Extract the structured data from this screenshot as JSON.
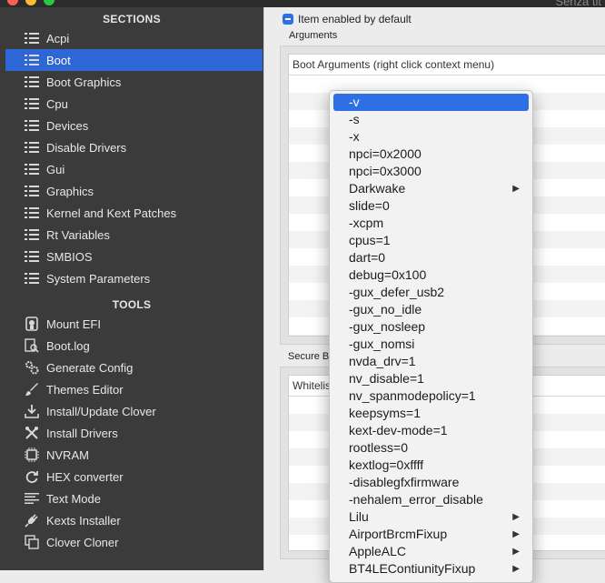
{
  "window": {
    "title": "Senza tit"
  },
  "sidebar": {
    "sections_header": "SECTIONS",
    "sections": [
      {
        "label": "Acpi",
        "icon": "list-icon"
      },
      {
        "label": "Boot",
        "icon": "list-icon",
        "selected": true
      },
      {
        "label": "Boot Graphics",
        "icon": "list-icon"
      },
      {
        "label": "Cpu",
        "icon": "list-icon"
      },
      {
        "label": "Devices",
        "icon": "list-icon"
      },
      {
        "label": "Disable Drivers",
        "icon": "list-icon"
      },
      {
        "label": "Gui",
        "icon": "list-icon"
      },
      {
        "label": "Graphics",
        "icon": "list-icon"
      },
      {
        "label": "Kernel and Kext Patches",
        "icon": "list-icon"
      },
      {
        "label": "Rt Variables",
        "icon": "list-icon"
      },
      {
        "label": "SMBIOS",
        "icon": "list-icon"
      },
      {
        "label": "System Parameters",
        "icon": "list-icon"
      }
    ],
    "tools_header": "TOOLS",
    "tools": [
      {
        "label": "Mount EFI",
        "icon": "disk-icon"
      },
      {
        "label": "Boot.log",
        "icon": "log-search-icon"
      },
      {
        "label": "Generate Config",
        "icon": "gears-icon"
      },
      {
        "label": "Themes Editor",
        "icon": "brush-icon"
      },
      {
        "label": "Install/Update Clover",
        "icon": "download-icon"
      },
      {
        "label": "Install Drivers",
        "icon": "tools-icon"
      },
      {
        "label": "NVRAM",
        "icon": "chip-icon"
      },
      {
        "label": "HEX converter",
        "icon": "cycle-icon"
      },
      {
        "label": "Text Mode",
        "icon": "text-lines-icon"
      },
      {
        "label": "Kexts Installer",
        "icon": "plug-icon"
      },
      {
        "label": "Clover Cloner",
        "icon": "clone-icon"
      }
    ]
  },
  "main": {
    "enabled_checkbox": {
      "label": "Item enabled by default",
      "checked": true
    },
    "arguments_group": {
      "title": "Arguments",
      "header": "Boot Arguments (right click context menu)"
    },
    "secure_group": {
      "title": "Secure B",
      "header": "Whitelist"
    }
  },
  "context_menu": {
    "items": [
      {
        "label": "-v",
        "highlighted": true
      },
      {
        "label": "-s"
      },
      {
        "label": "-x"
      },
      {
        "label": "npci=0x2000"
      },
      {
        "label": "npci=0x3000"
      },
      {
        "label": "Darkwake",
        "submenu": true
      },
      {
        "label": "slide=0"
      },
      {
        "label": "-xcpm"
      },
      {
        "label": "cpus=1"
      },
      {
        "label": "dart=0"
      },
      {
        "label": "debug=0x100"
      },
      {
        "label": "-gux_defer_usb2"
      },
      {
        "label": "-gux_no_idle"
      },
      {
        "label": "-gux_nosleep"
      },
      {
        "label": "-gux_nomsi"
      },
      {
        "label": "nvda_drv=1"
      },
      {
        "label": "nv_disable=1"
      },
      {
        "label": "nv_spanmodepolicy=1"
      },
      {
        "label": "keepsyms=1"
      },
      {
        "label": "kext-dev-mode=1"
      },
      {
        "label": "rootless=0"
      },
      {
        "label": "kextlog=0xffff"
      },
      {
        "label": "-disablegfxfirmware"
      },
      {
        "label": "-nehalem_error_disable"
      },
      {
        "label": "Lilu",
        "submenu": true
      },
      {
        "label": "AirportBrcmFixup",
        "submenu": true
      },
      {
        "label": "AppleALC",
        "submenu": true
      },
      {
        "label": "BT4LEContiunityFixup",
        "submenu": true
      }
    ]
  },
  "colors": {
    "selection": "#2f66d6",
    "sidebar_bg": "#3b3b3b",
    "menu_highlight": "#2f6fe4"
  }
}
